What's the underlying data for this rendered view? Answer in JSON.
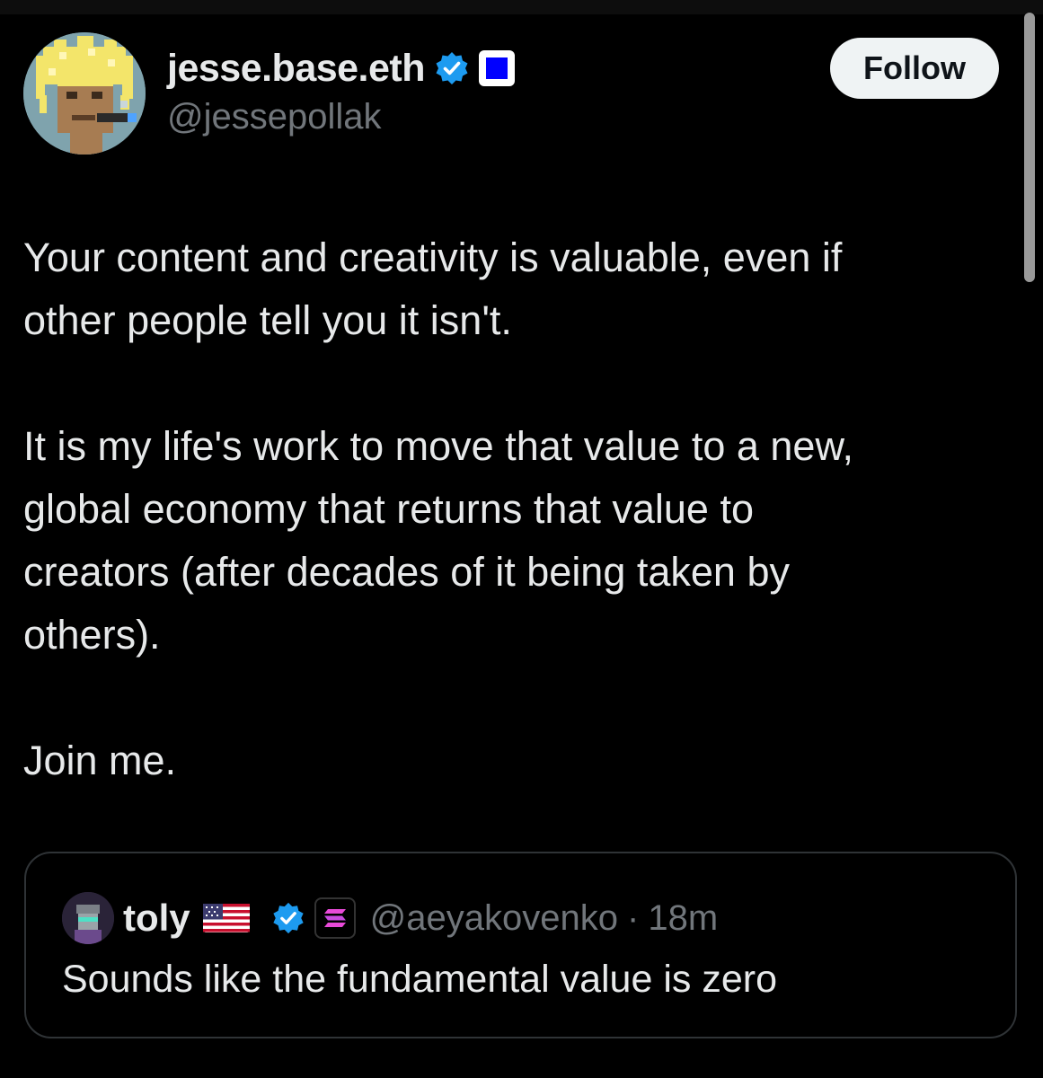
{
  "post": {
    "author": {
      "display_name": "jesse.base.eth",
      "handle": "@jessepollak",
      "verified_icon": "verified-badge-icon",
      "affiliate_icon": "base-square-icon"
    },
    "follow_label": "Follow",
    "body": {
      "line1": "Your content and creativity is valuable, even if",
      "line2": "other people tell you it isn't.",
      "line3": "It is my life's work to move that value to a new,",
      "line4": "global economy that returns that value to",
      "line5": "creators (after decades of it being taken by",
      "line6": "others).",
      "line7": "Join me."
    },
    "quote": {
      "display_name": "toly",
      "flag_icon": "us-flag-icon",
      "verified_icon": "verified-badge-icon",
      "affiliate_icon": "solana-icon",
      "handle": "@aeyakovenko",
      "separator": "·",
      "time": "18m",
      "text": "Sounds like the fundamental value is zero"
    }
  },
  "colors": {
    "background": "#000000",
    "text_primary": "#e7e9ea",
    "text_secondary": "#71767b",
    "verified_blue": "#1d9bf0",
    "follow_button_bg": "#eff3f4",
    "card_border": "#2f3336",
    "base_blue": "#0000ff"
  }
}
